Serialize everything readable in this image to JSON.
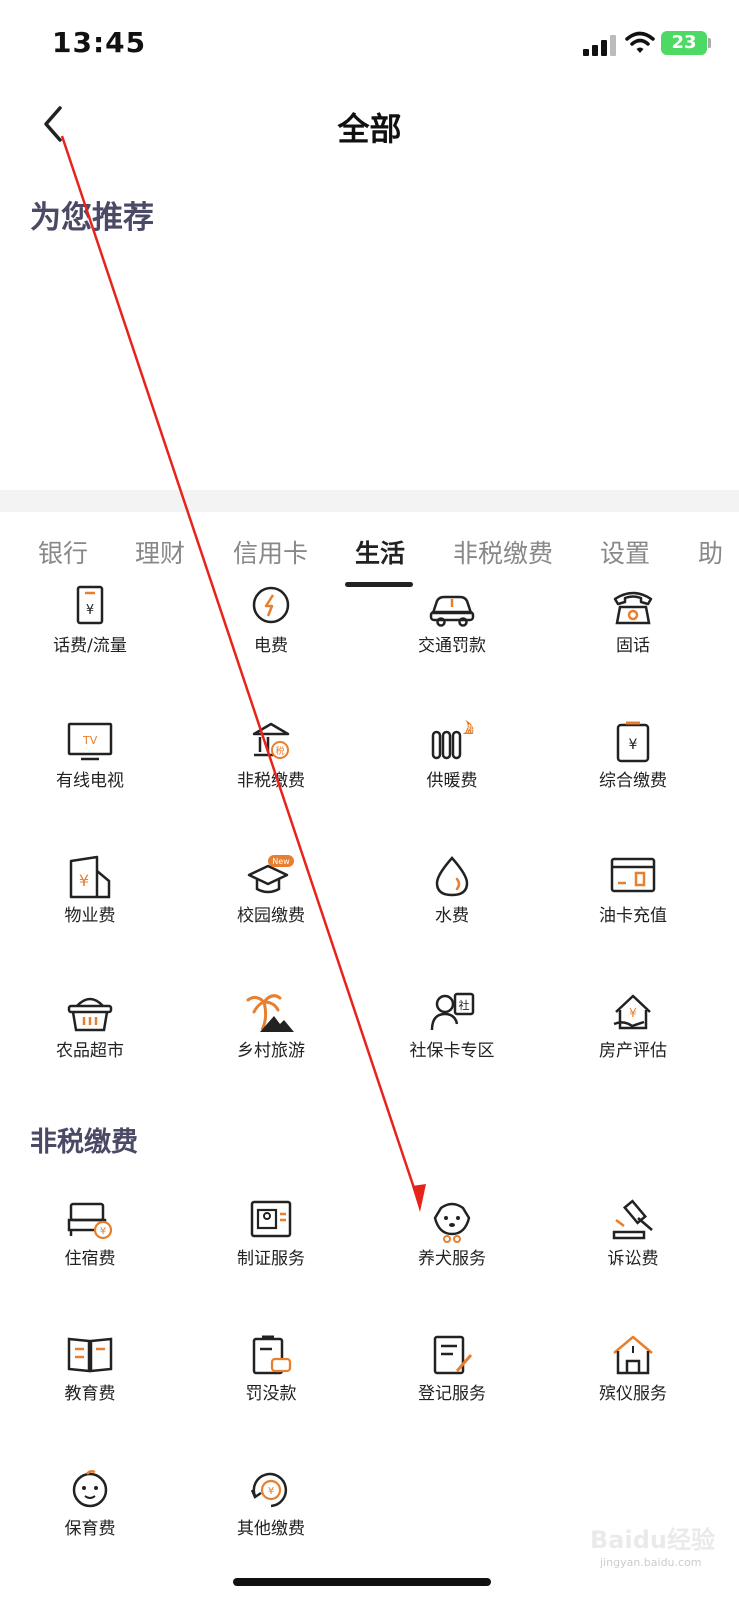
{
  "status": {
    "time": "13:45",
    "battery": "23"
  },
  "nav": {
    "title": "全部"
  },
  "recommend": {
    "title": "为您推荐"
  },
  "tabs": [
    {
      "label": "银行"
    },
    {
      "label": "理财"
    },
    {
      "label": "信用卡"
    },
    {
      "label": "生活",
      "active": true
    },
    {
      "label": "非税缴费"
    },
    {
      "label": "设置"
    },
    {
      "label": "助"
    }
  ],
  "life": {
    "items": [
      {
        "label": "话费/流量",
        "icon": "phone-bill-icon"
      },
      {
        "label": "电费",
        "icon": "electricity-icon"
      },
      {
        "label": "交通罚款",
        "icon": "car-icon"
      },
      {
        "label": "固话",
        "icon": "telephone-icon"
      },
      {
        "label": "有线电视",
        "icon": "tv-icon"
      },
      {
        "label": "非税缴费",
        "icon": "tax-building-icon"
      },
      {
        "label": "供暖费",
        "icon": "radiator-icon"
      },
      {
        "label": "综合缴费",
        "icon": "bill-icon"
      },
      {
        "label": "物业费",
        "icon": "property-icon"
      },
      {
        "label": "校园缴费",
        "icon": "graduation-cap-icon"
      },
      {
        "label": "水费",
        "icon": "water-drop-icon"
      },
      {
        "label": "油卡充值",
        "icon": "fuel-card-icon"
      },
      {
        "label": "农品超市",
        "icon": "basket-icon"
      },
      {
        "label": "乡村旅游",
        "icon": "palm-tree-icon"
      },
      {
        "label": "社保卡专区",
        "icon": "social-security-icon"
      },
      {
        "label": "房产评估",
        "icon": "house-valuation-icon"
      }
    ],
    "badges": {
      "hot": "热",
      "new": "New",
      "tax": "税",
      "she": "社",
      "yen": "¥",
      "tv": "TV"
    }
  },
  "nontax": {
    "title": "非税缴费",
    "items": [
      {
        "label": "住宿费",
        "icon": "bed-icon"
      },
      {
        "label": "制证服务",
        "icon": "id-card-icon"
      },
      {
        "label": "养犬服务",
        "icon": "dog-icon"
      },
      {
        "label": "诉讼费",
        "icon": "gavel-icon"
      },
      {
        "label": "教育费",
        "icon": "book-icon"
      },
      {
        "label": "罚没款",
        "icon": "clipboard-car-icon"
      },
      {
        "label": "登记服务",
        "icon": "document-edit-icon"
      },
      {
        "label": "殡仪服务",
        "icon": "funeral-home-icon"
      },
      {
        "label": "保育费",
        "icon": "baby-face-icon"
      },
      {
        "label": "其他缴费",
        "icon": "refresh-yen-icon"
      }
    ]
  },
  "watermark": {
    "text": "Baidu经验",
    "sub": "jingyan.baidu.com"
  },
  "colors": {
    "accent": "#e87f2e",
    "annotation": "#e8231b",
    "title": "#4a4a66"
  }
}
